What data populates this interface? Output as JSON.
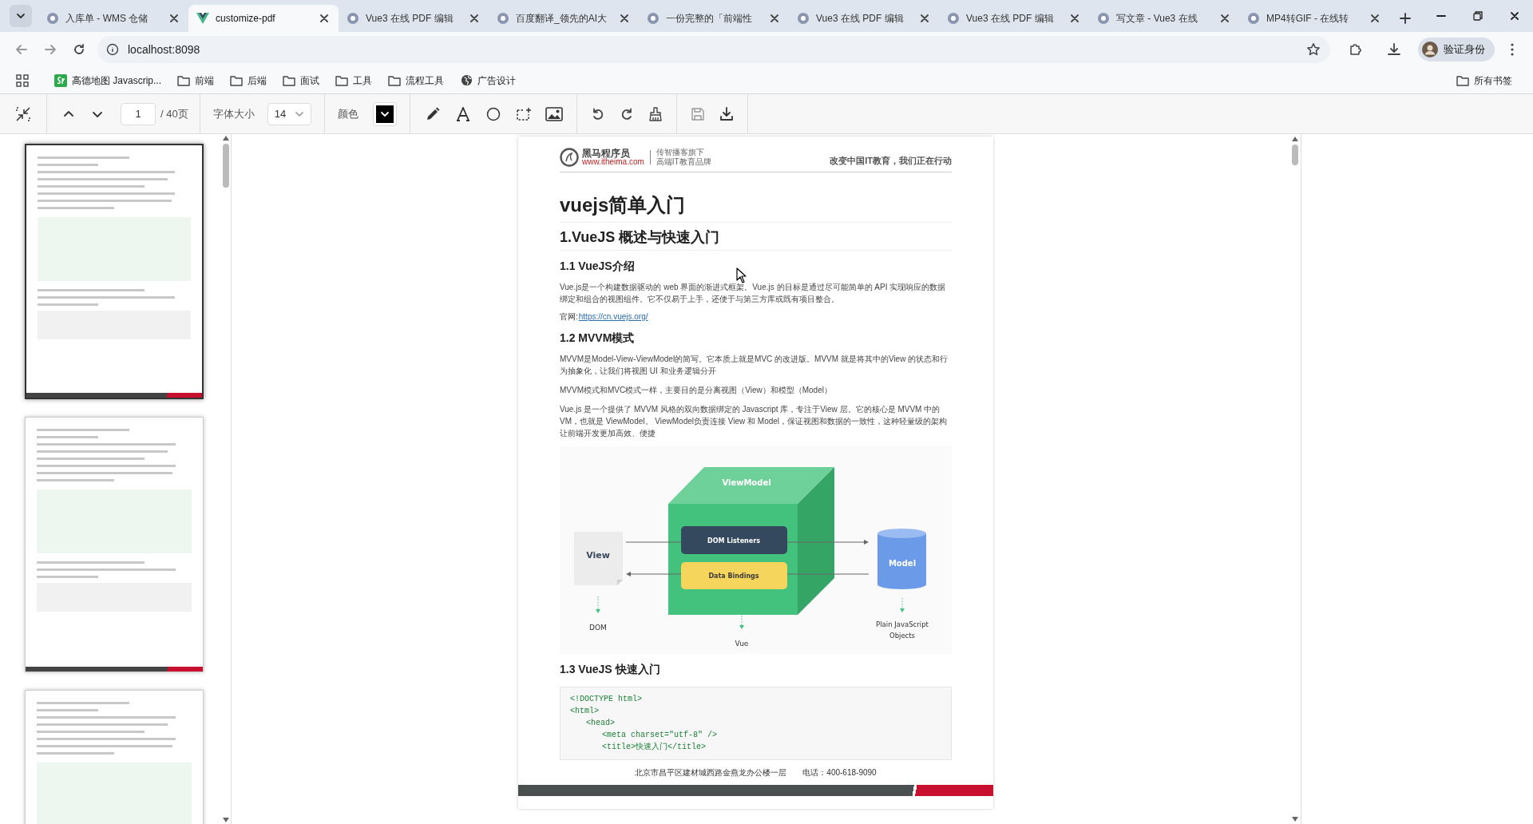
{
  "browser": {
    "tabs": [
      {
        "title": "入库单 - WMS 仓储",
        "selected": false
      },
      {
        "title": "customize-pdf",
        "selected": true
      },
      {
        "title": "Vue3 在线 PDF 编辑",
        "selected": false
      },
      {
        "title": "百度翻译_领先的AI大",
        "selected": false
      },
      {
        "title": "一份完整的「前端性",
        "selected": false
      },
      {
        "title": "Vue3 在线 PDF 编辑",
        "selected": false
      },
      {
        "title": "Vue3 在线 PDF 编辑",
        "selected": false
      },
      {
        "title": "写文章 - Vue3 在线",
        "selected": false
      },
      {
        "title": "MP4转GIF - 在线转",
        "selected": false
      }
    ],
    "address": "localhost:8098",
    "profile": "验证身份",
    "bookmarks": [
      {
        "label": "高德地图 Javascrip...",
        "kind": "site"
      },
      {
        "label": "前端",
        "kind": "folder"
      },
      {
        "label": "后端",
        "kind": "folder"
      },
      {
        "label": "面试",
        "kind": "folder"
      },
      {
        "label": "工具",
        "kind": "folder"
      },
      {
        "label": "流程工具",
        "kind": "folder"
      },
      {
        "label": "广告设计",
        "kind": "globe"
      }
    ],
    "all_bookmarks": "所有书签"
  },
  "toolbar": {
    "page_input": "1",
    "page_total": "/ 40页",
    "font_size_label": "字体大小",
    "font_size": "14",
    "color_label": "颜色",
    "color": "#000000"
  },
  "thumbnails": [
    {
      "selected": true
    },
    {
      "selected": false
    },
    {
      "selected": false
    }
  ],
  "pdf_page": {
    "logo_name": "黑马程序员",
    "logo_url": "www.itheima.com",
    "logo_tagline_1": "传智播客旗下",
    "logo_tagline_2": "高端IT教育品牌",
    "slogan": "改变中国IT教育，我们正在行动",
    "blocks": [
      {
        "kind": "h1",
        "text": "vuejs简单入门"
      },
      {
        "kind": "h2",
        "text": "1.VueJS 概述与快速入门"
      },
      {
        "kind": "h3",
        "text": "1.1 VueJS介绍"
      },
      {
        "kind": "p",
        "text": "Vue.js是一个构建数据驱动的 web 界面的渐进式框架。Vue.js 的目标是通过尽可能简单的 API 实现响应的数据绑定和组合的视图组件。它不仅易于上手，还便于与第三方库或既有项目整合。"
      },
      {
        "kind": "link",
        "label": "官网:",
        "url": "https://cn.vuejs.org/"
      },
      {
        "kind": "h3",
        "text": "1.2 MVVM模式"
      },
      {
        "kind": "p",
        "text": "MVVM是Model-View-ViewModel的简写。它本质上就是MVC 的改进版。MVVM 就是将其中的View 的状态和行为抽象化，让我们将视图 UI 和业务逻辑分开"
      },
      {
        "kind": "p",
        "text": "MVVM模式和MVC模式一样，主要目的是分离视图（View）和模型（Model）"
      },
      {
        "kind": "p",
        "text": "Vue.js 是一个提供了 MVVM 风格的双向数据绑定的 Javascript 库，专注于View 层。它的核心是 MVVM 中的 VM，也就是 ViewModel。 ViewModel负责连接 View 和 Model，保证视图和数据的一致性，这种轻量级的架构让前端开发更加高效、便捷"
      },
      {
        "kind": "diagram",
        "view": "View",
        "viewmodel": "ViewModel",
        "listeners": "DOM Listeners",
        "bindings": "Data Bindings",
        "model": "Model",
        "dom": "DOM",
        "vue": "Vue",
        "objects_1": "Plain JavaScript",
        "objects_2": "Objects"
      },
      {
        "kind": "h3",
        "text": "1.3 VueJS 快速入门"
      },
      {
        "kind": "code",
        "lines": [
          {
            "text": "<!DOCTYPE html>"
          },
          {
            "text": "<html>",
            "children": [
              {
                "text": "<head>",
                "children": [
                  {
                    "text": "<meta charset=\"utf-8\" />"
                  },
                  {
                    "text": "<title>快速入门</title>"
                  }
                ]
              }
            ]
          }
        ]
      }
    ],
    "footer_address": "北京市昌平区建材城西路金燕龙办公楼一层",
    "footer_phone": "电话：400-618-9090"
  }
}
